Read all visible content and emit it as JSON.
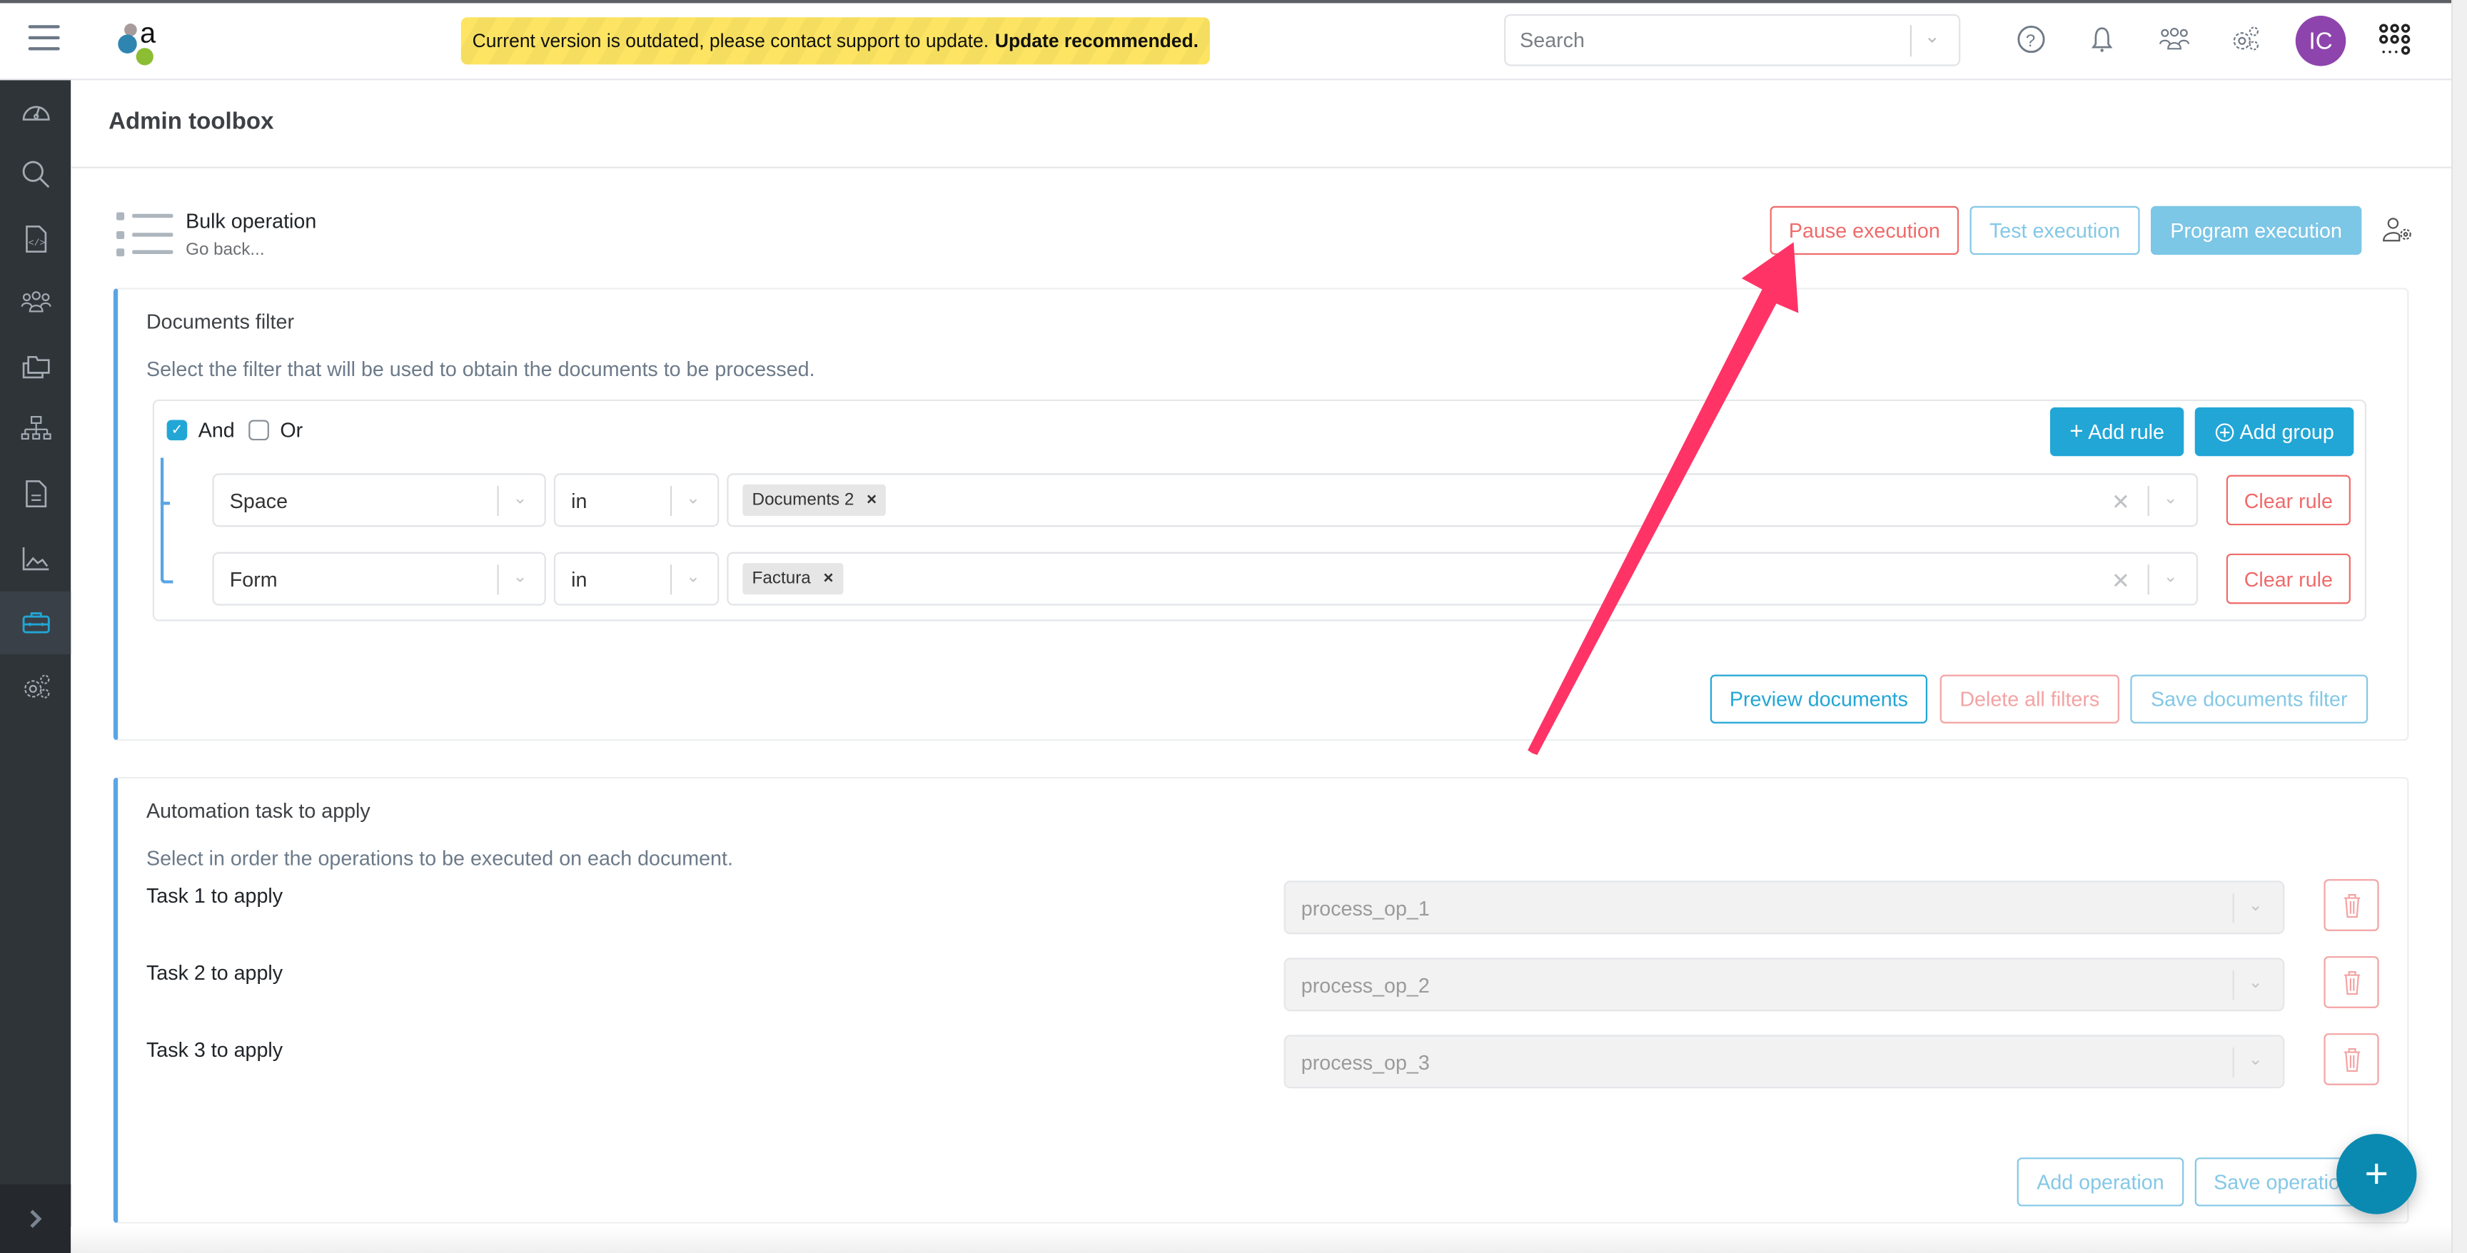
{
  "header": {
    "banner_text": "Current version is outdated, please contact support to update.",
    "banner_bold": "Update recommended.",
    "search_placeholder": "Search",
    "avatar_initials": "IC",
    "icons": [
      "help-icon",
      "bell-icon",
      "users-icon",
      "settings-icon",
      "apps-grid-icon"
    ]
  },
  "sidebar": {
    "items": [
      {
        "icon": "dashboard-icon"
      },
      {
        "icon": "search-icon"
      },
      {
        "icon": "code-file-icon"
      },
      {
        "icon": "users-icon"
      },
      {
        "icon": "folders-icon"
      },
      {
        "icon": "hierarchy-icon"
      },
      {
        "icon": "document-icon"
      },
      {
        "icon": "chart-icon"
      },
      {
        "icon": "toolbox-icon",
        "active": true
      },
      {
        "icon": "settings-icon"
      }
    ],
    "expand_icon": "chevron-right-icon"
  },
  "page": {
    "title": "Admin toolbox",
    "bulk_title": "Bulk operation",
    "go_back": "Go back...",
    "actions": {
      "pause": "Pause execution",
      "test": "Test execution",
      "program": "Program execution"
    }
  },
  "filter": {
    "title": "Documents filter",
    "description": "Select the filter that will be used to obtain the documents to be processed.",
    "and_label": "And",
    "or_label": "Or",
    "and_checked": true,
    "or_checked": false,
    "add_rule": "Add rule",
    "add_group": "Add group",
    "rules": [
      {
        "field": "Space",
        "operator": "in",
        "values": [
          "Documents 2"
        ],
        "clear": "Clear rule"
      },
      {
        "field": "Form",
        "operator": "in",
        "values": [
          "Factura"
        ],
        "clear": "Clear rule"
      }
    ],
    "preview": "Preview documents",
    "delete_all": "Delete all filters",
    "save": "Save documents filter"
  },
  "automation": {
    "title": "Automation task to apply",
    "description": "Select in order the operations to be executed on each document.",
    "tasks": [
      {
        "label": "Task 1 to apply",
        "value": "process_op_1"
      },
      {
        "label": "Task 2 to apply",
        "value": "process_op_2"
      },
      {
        "label": "Task 3 to apply",
        "value": "process_op_3"
      }
    ],
    "add_operation": "Add operation",
    "save_operations": "Save operations"
  },
  "fab": {
    "label": "+"
  },
  "colors": {
    "accent": "#22a6d6",
    "danger": "#ef6b6b",
    "avatar": "#8e44ad",
    "annotation_arrow": "#ff3366",
    "fab": "#0a8ab0"
  }
}
